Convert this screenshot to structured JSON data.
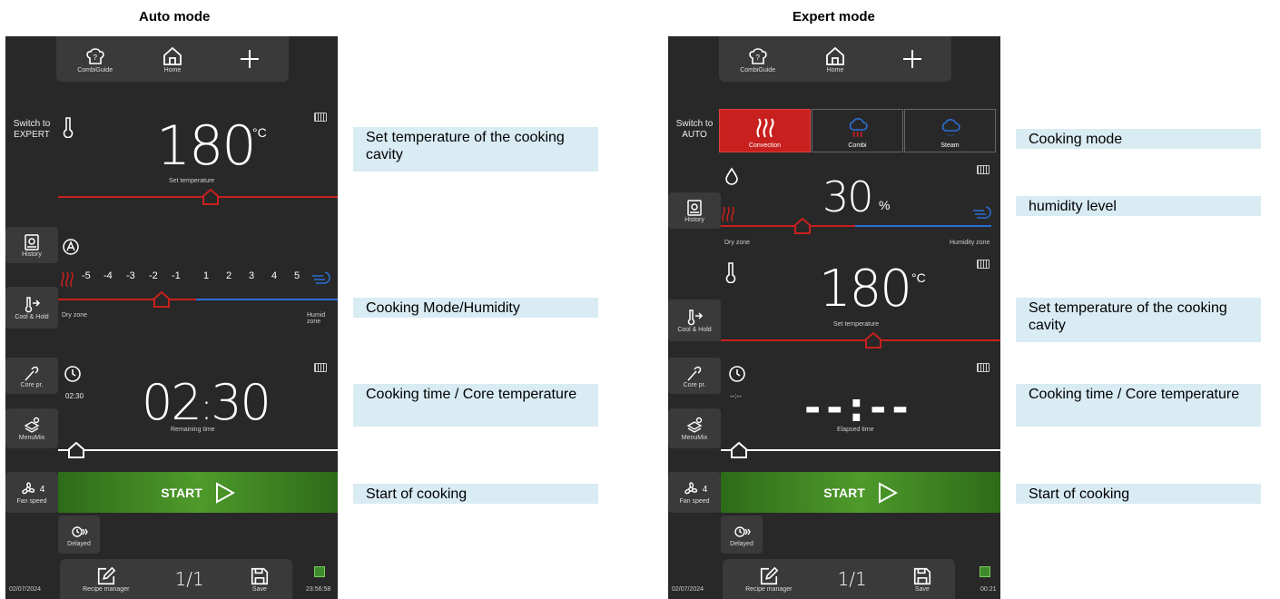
{
  "auto": {
    "title": "Auto mode",
    "topbar": {
      "combiguide": "CombiGuide",
      "home": "Home"
    },
    "switch_label_line1": "Switch to",
    "switch_label_line2": "EXPERT",
    "temperature": {
      "value": "180",
      "unit": "°C",
      "label": "Set temperature"
    },
    "humidity_scale": [
      "-5",
      "-4",
      "-3",
      "-2",
      "-1",
      "1",
      "2",
      "3",
      "4",
      "5"
    ],
    "dry_zone": "Dry zone",
    "humid_zone": "Humid zone",
    "time": {
      "small": "02:30",
      "hh": "02",
      "mm": "30",
      "label": "Remaining time"
    },
    "fan_level": "4",
    "start_label": "START",
    "side": {
      "history": "History",
      "cool_hold": "Cool & Hold",
      "core": "Core pr.",
      "menumix": "MenuMix",
      "fan": "Fan speed",
      "delayed": "Delayed"
    },
    "bottom": {
      "recipe": "Recipe manager",
      "page": "1/1",
      "save": "Save"
    },
    "date": "02/07/2024",
    "clock": "23:56:58"
  },
  "expert": {
    "title": "Expert mode",
    "topbar": {
      "combiguide": "CombiGuide",
      "home": "Home"
    },
    "switch_label_line1": "Switch to",
    "switch_label_line2": "AUTO",
    "modes": [
      {
        "label": "Convection"
      },
      {
        "label": "Combi"
      },
      {
        "label": "Steam"
      }
    ],
    "humidity": {
      "value": "30",
      "unit": "%",
      "dry": "Dry zone",
      "humid": "Humidity zone"
    },
    "temperature": {
      "value": "180",
      "unit": "°C",
      "label": "Set temperature"
    },
    "time": {
      "small": "--:--",
      "display": "--:--",
      "label": "Elapsed time"
    },
    "fan_level": "4",
    "start_label": "START",
    "side": {
      "history": "History",
      "cool_hold": "Cool & Hold",
      "core": "Core pr.",
      "menumix": "MenuMix",
      "fan": "Fan speed",
      "delayed": "Delayed"
    },
    "bottom": {
      "recipe": "Recipe manager",
      "page": "1/1",
      "save": "Save"
    },
    "date": "02/07/2024",
    "clock": "00:21"
  },
  "callouts_auto": [
    {
      "text": "Set temperature of the cooking cavity"
    },
    {
      "text": "Cooking Mode/Humidity"
    },
    {
      "text": "Cooking time / Core temperature"
    },
    {
      "text": "Start of cooking"
    }
  ],
  "callouts_expert": [
    {
      "text": "Cooking mode"
    },
    {
      "text": "humidity level"
    },
    {
      "text": "Set temperature of the cooking cavity"
    },
    {
      "text": "Cooking time / Core temperature"
    },
    {
      "text": "Start of cooking"
    }
  ],
  "colors": {
    "panel": "#282828",
    "red": "#c8201e",
    "blue": "#2a6fd6",
    "green": "#4e9a2a"
  }
}
